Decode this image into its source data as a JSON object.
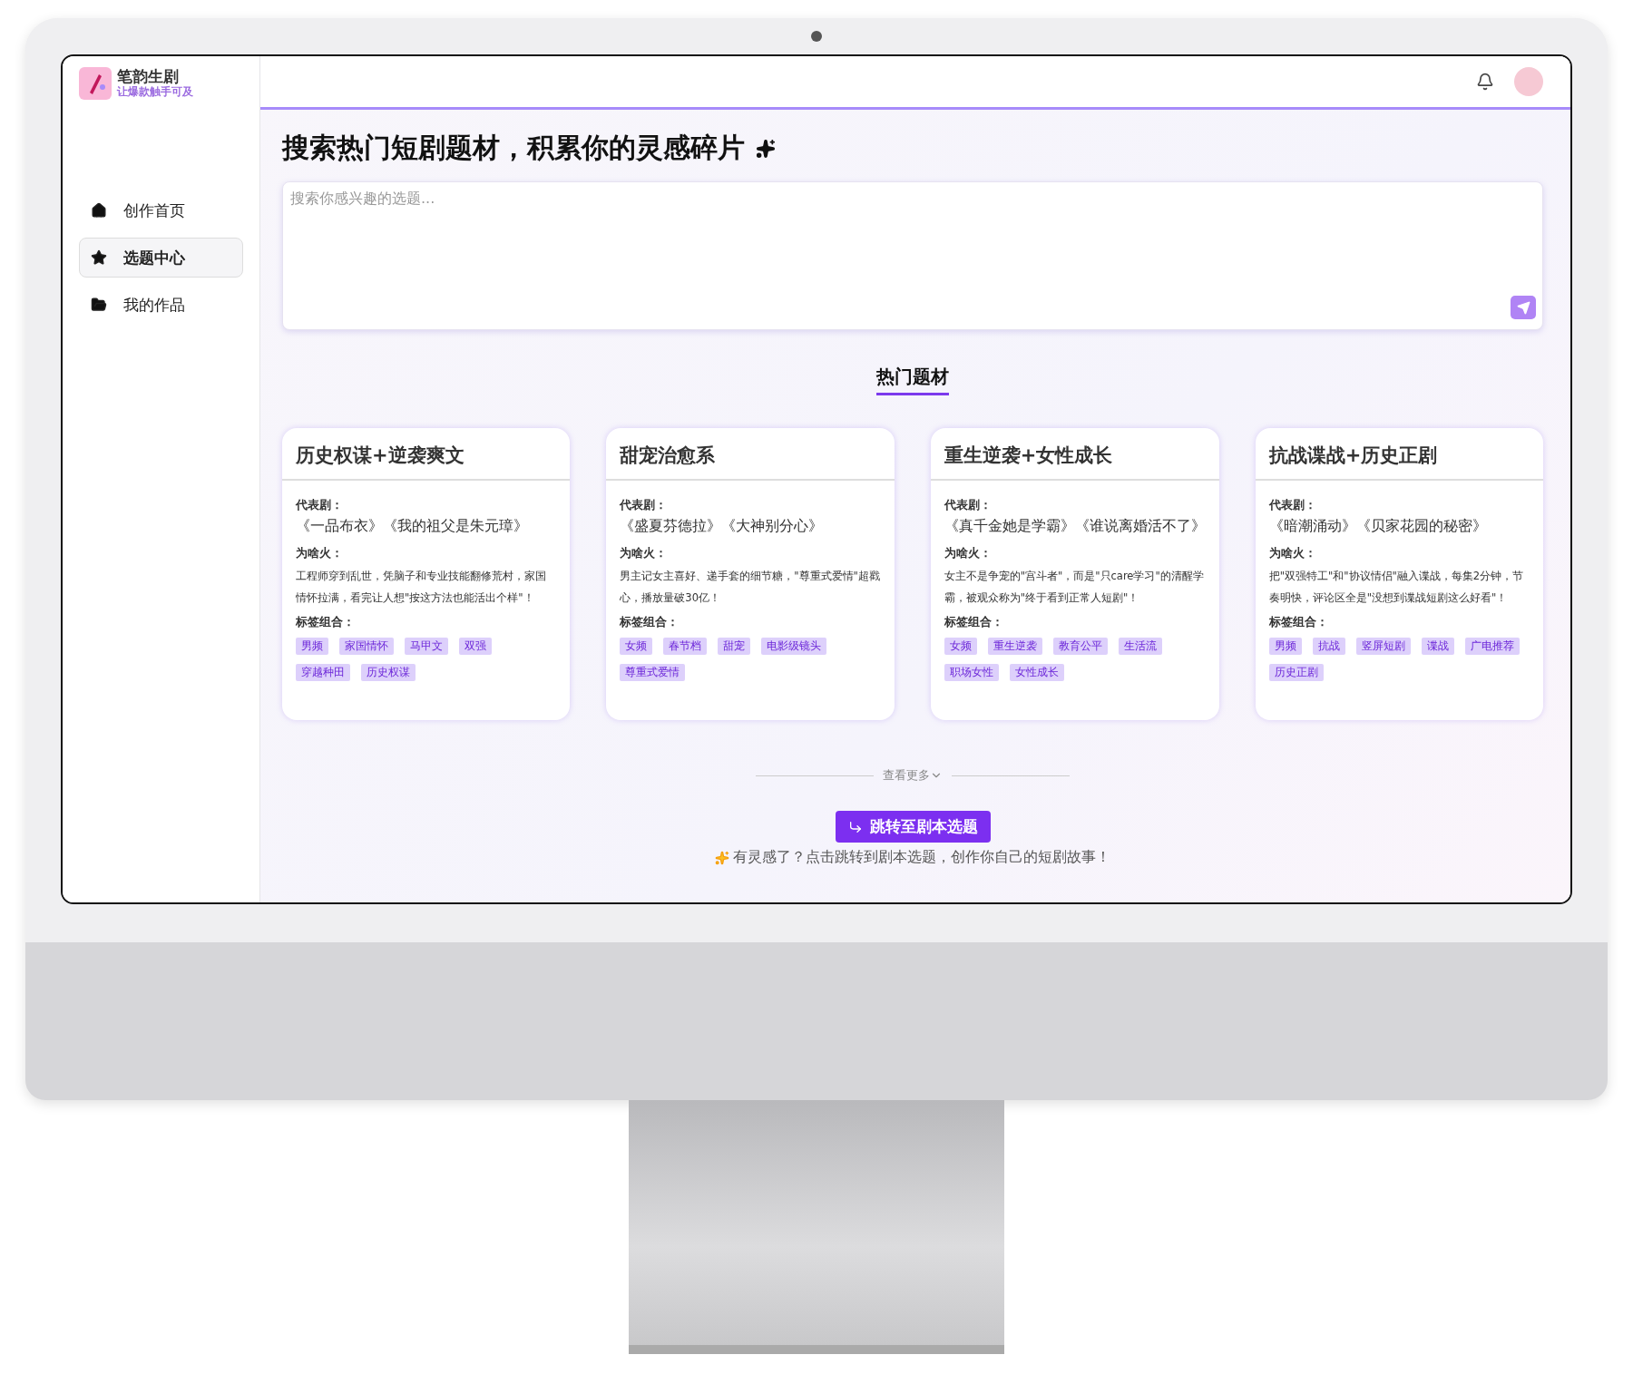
{
  "brand": {
    "name": "笔韵生剧",
    "slogan": "让爆款触手可及"
  },
  "sidebar": {
    "items": [
      {
        "label": "创作首页",
        "kind": "home",
        "selected": false
      },
      {
        "label": "选题中心",
        "kind": "star",
        "selected": true
      },
      {
        "label": "我的作品",
        "kind": "folder",
        "selected": false
      }
    ]
  },
  "heading": "搜索热门短剧题材，积累你的灵感碎片",
  "search": {
    "placeholder": "搜索你感兴趣的选题..."
  },
  "tabs": [
    {
      "label": "热门题材",
      "selected": true
    }
  ],
  "cards": [
    {
      "title": "历史权谋+逆袭爽文",
      "works_label": "代表剧：",
      "works": "《一品布衣》《我的祖父是朱元璋》",
      "reason_label": "为啥火：",
      "reason": "工程师穿到乱世，凭脑子和专业技能翻修荒村，家国情怀拉满，看完让人想\"按这方法也能活出个样\"！",
      "tags_label": "标签组合：",
      "tags": [
        "男频",
        "家国情怀",
        "马甲文",
        "双强",
        "穿越种田",
        "历史权谋"
      ]
    },
    {
      "title": "甜宠治愈系",
      "works_label": "代表剧：",
      "works": "《盛夏芬德拉》《大神别分心》",
      "reason_label": "为啥火：",
      "reason": "男主记女主喜好、递手套的细节糖，\"尊重式爱情\"超戳心，播放量破30亿！",
      "tags_label": "标签组合：",
      "tags": [
        "女频",
        "春节档",
        "甜宠",
        "电影级镜头",
        "尊重式爱情"
      ]
    },
    {
      "title": "重生逆袭+女性成长",
      "works_label": "代表剧：",
      "works": "《真千金她是学霸》《谁说离婚活不了》",
      "reason_label": "为啥火：",
      "reason": "女主不是争宠的\"宫斗者\"，而是\"只care学习\"的清醒学霸，被观众称为\"终于看到正常人短剧\"！",
      "tags_label": "标签组合：",
      "tags": [
        "女频",
        "重生逆袭",
        "教育公平",
        "生活流",
        "职场女性",
        "女性成长"
      ]
    },
    {
      "title": "抗战谍战+历史正剧",
      "works_label": "代表剧：",
      "works": "《暗潮涌动》《贝家花园的秘密》",
      "reason_label": "为啥火：",
      "reason": "把\"双强特工\"和\"协议情侣\"融入谍战，每集2分钟，节奏明快，评论区全是\"没想到谍战短剧这么好看\"！",
      "tags_label": "标签组合：",
      "tags": [
        "男频",
        "抗战",
        "竖屏短剧",
        "谍战",
        "广电推荐",
        "历史正剧"
      ]
    }
  ],
  "more": "查看更多",
  "jump_button": "跳转至剧本选题",
  "hint": "有灵感了？点击跳转到剧本选题，创作你自己的短剧故事！"
}
